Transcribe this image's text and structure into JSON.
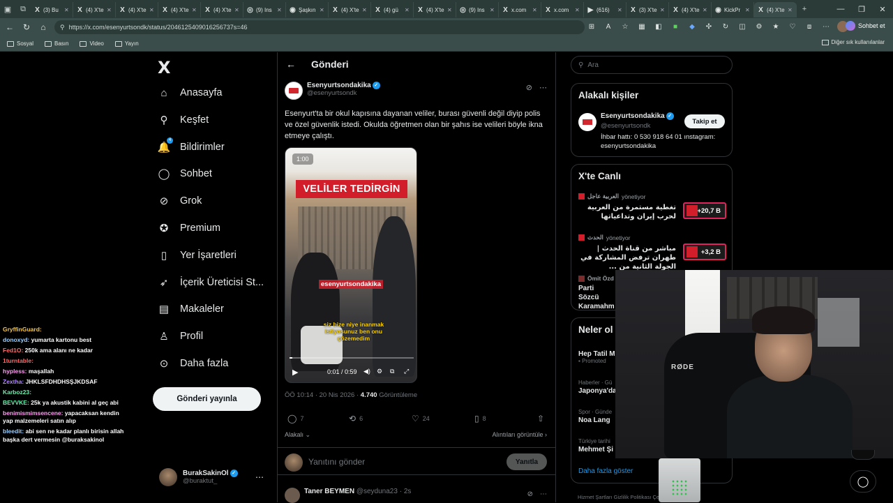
{
  "browser": {
    "tabs": [
      {
        "icon": "X",
        "title": "(3) Bu",
        "active": false
      },
      {
        "icon": "X",
        "title": "(4) X'te",
        "active": false
      },
      {
        "icon": "X",
        "title": "(4) X'te",
        "active": false
      },
      {
        "icon": "X",
        "title": "(4) X'te",
        "active": false
      },
      {
        "icon": "X",
        "title": "(4) X'te",
        "active": false
      },
      {
        "icon": "◎",
        "title": "(9) Ins",
        "active": false
      },
      {
        "icon": "◉",
        "title": "Şaşkın",
        "active": false
      },
      {
        "icon": "X",
        "title": "(4) X'te",
        "active": false
      },
      {
        "icon": "X",
        "title": "(4) gü",
        "active": false
      },
      {
        "icon": "X",
        "title": "(4) X'te",
        "active": false
      },
      {
        "icon": "◎",
        "title": "(9) Ins",
        "active": false
      },
      {
        "icon": "X",
        "title": "x.com",
        "active": false
      },
      {
        "icon": "X",
        "title": "x.com",
        "active": false
      },
      {
        "icon": "▶",
        "title": "(616)",
        "active": false
      },
      {
        "icon": "X",
        "title": "(3) X'te",
        "active": false
      },
      {
        "icon": "X",
        "title": "(4) X'te",
        "active": false
      },
      {
        "icon": "◉",
        "title": "KickPr",
        "active": false
      },
      {
        "icon": "X",
        "title": "(4) X'te",
        "active": true
      }
    ],
    "url": "https://x.com/esenyurtsondk/status/2046125409016256737s=46",
    "chat_button": "Sohbet et",
    "bookmarks": [
      "Sosyal",
      "Basın",
      "Video",
      "Yayın"
    ],
    "other_bookmarks": "Diğer sık kullanılanlar"
  },
  "nav": {
    "logo": "X",
    "items": [
      {
        "label": "Anasayfa",
        "icon": "home-icon"
      },
      {
        "label": "Keşfet",
        "icon": "search-icon"
      },
      {
        "label": "Bildirimler",
        "icon": "bell-icon"
      },
      {
        "label": "Sohbet",
        "icon": "chat-icon"
      },
      {
        "label": "Grok",
        "icon": "grok-icon"
      },
      {
        "label": "Premium",
        "icon": "premium-icon"
      },
      {
        "label": "Yer İşaretleri",
        "icon": "bookmark-icon"
      },
      {
        "label": "İçerik Üreticisi St...",
        "icon": "rocket-icon"
      },
      {
        "label": "Makaleler",
        "icon": "article-icon"
      },
      {
        "label": "Profil",
        "icon": "person-icon"
      },
      {
        "label": "Daha fazla",
        "icon": "more-icon"
      }
    ],
    "post_button": "Gönderi yayınla",
    "profile": {
      "name": "BurakSakinOl",
      "handle": "@buraktut_"
    }
  },
  "chat_overlay": [
    {
      "user": "GryffinGuard:",
      "text": "",
      "color": "#f7c948"
    },
    {
      "user": "donoxyd:",
      "text": "yumarta kartonu best",
      "color": "#9ad0ff"
    },
    {
      "user": "Fed1O:",
      "text": "250k ama alanı ne kadar",
      "color": "#ff6b6b"
    },
    {
      "user": "1turntable:",
      "text": "",
      "color": "#ff6b6b"
    },
    {
      "user": "hypless:",
      "text": "maşallah",
      "color": "#ff9ff3"
    },
    {
      "user": "Zextha:",
      "text": "JHKLSFDHDHSŞJKDSAF",
      "color": "#b388ff"
    },
    {
      "user": "Karboz23:",
      "text": "",
      "color": "#69f0ae"
    },
    {
      "user": "BEVVKE:",
      "text": "25k ya akustik kabini al geç abi",
      "color": "#69f0ae"
    },
    {
      "user": "benimismimsencene:",
      "text": "yapacaksan kendin yap malzemeleri satın alıp",
      "color": "#ff9ff3"
    },
    {
      "user": "bleedit:",
      "text": "abi sen ne kadar planlı birisin allah başka dert vermesin @buraksakinol",
      "color": "#9ad0ff"
    }
  ],
  "post": {
    "header_title": "Gönderi",
    "author_name": "Esenyurtsondakika",
    "author_handle": "@esenyurtsondk",
    "text": "Esenyurt'ta bir okul kapısına dayanan veliler, burası güvenli değil diyip polis ve özel güvenlik istedi. Okulda öğretmen olan bir şahıs ise velileri böyle ikna etmeye çalıştı.",
    "video": {
      "duration_badge": "1:00",
      "headline": "VELİLER TEDİRGİN",
      "brand": "esenyurtsondakika",
      "subtitle": "siz bize niye inanmak istiyosunuz ben onu çözemedim",
      "time": "0:01 / 0:59",
      "progress": 0.02
    },
    "timestamp": "ÖÖ 10:14 · 20 Nis 2026 · ",
    "views": "4.740",
    "views_label": " Görüntüleme",
    "stats": {
      "replies": "7",
      "reposts": "6",
      "likes": "24",
      "bookmarks": "8"
    },
    "related_label": "Alakalı",
    "quotes_label": "Alıntıları görüntüle",
    "reply_placeholder": "Yanıtını gönder",
    "reply_button": "Yanıtla",
    "next_post": {
      "name": "Taner BEYMEN",
      "handle": "@seyduna23 · 2s"
    }
  },
  "sidebar": {
    "search_placeholder": "Ara",
    "related_title": "Alakalı kişiler",
    "related_person": {
      "name": "Esenyurtsondakika",
      "handle": "@esenyurtsondk",
      "bio": "İhbar hattı: 0 530 918 64 01 ınstagram: esenyurtsondakika",
      "follow_label": "Takip et"
    },
    "live_title": "X'te Canlı",
    "live": [
      {
        "source": "العربية عاجل",
        "status": "yönetiyor",
        "text": "تغطية مستمرة من العربية لحرب إيران وتداعياتها",
        "count": "+20,7 B"
      },
      {
        "source": "الحدث",
        "status": "yönetiyor",
        "text": "مباشر من قناة الحدث | طهران ترفض المشاركة في الجولة الثانية من ...",
        "count": "+3,2 B"
      }
    ],
    "live_partial": {
      "source": "Ömit Özd",
      "text": "Parti Sözcü Karamahm"
    },
    "news_title": "Neler ol",
    "trends": [
      {
        "category": "",
        "title": "Hep Tatil M",
        "promoted": "Promoted"
      },
      {
        "category": "Haberler · Gü",
        "title": "Japonya'da"
      },
      {
        "category": "Spor · Günde",
        "title": "Noa Lang"
      },
      {
        "category": "Türkiye tarihi",
        "title": "Mehmet Şi"
      }
    ],
    "show_more": "Daha fazla göster",
    "footer": "Hizmet Şartları   Gizlilik Politikası   Çerez Politikası"
  },
  "webcam": {
    "mic_brand": "RØDE"
  }
}
